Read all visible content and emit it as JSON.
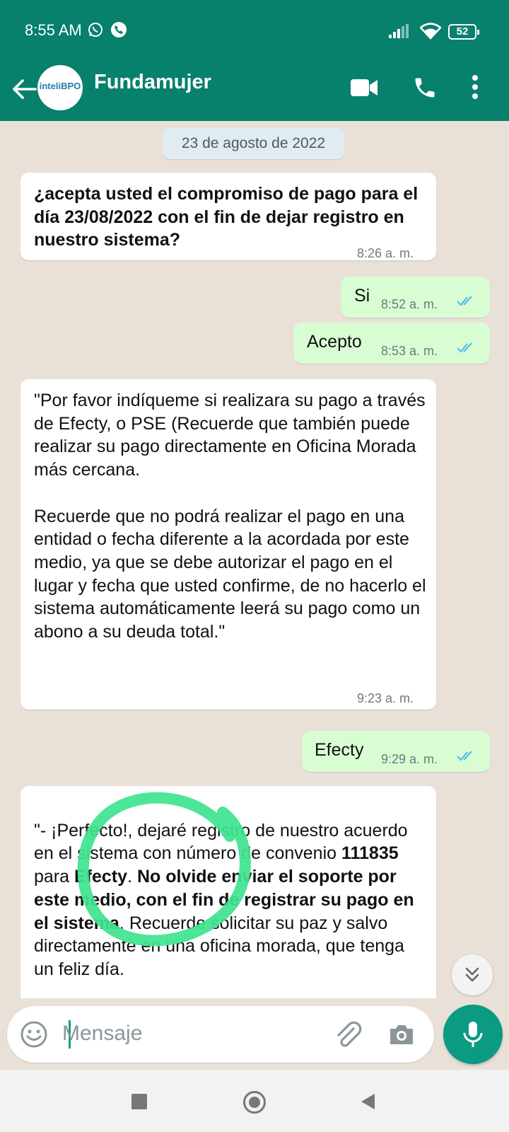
{
  "status_bar": {
    "time": "8:55 AM",
    "battery": "52"
  },
  "header": {
    "contact_name": "Fundamujer",
    "avatar_text": "inteliBPO"
  },
  "chat": {
    "date_separator": "23 de agosto de 2022",
    "messages": [
      {
        "direction": "incoming",
        "text": "¿acepta usted el compromiso de pago para el día 23/08/2022 con el fin de dejar registro en nuestro sistema?",
        "time": "8:26 a. m."
      },
      {
        "direction": "outgoing",
        "text": "Si",
        "time": "8:52 a. m.",
        "status": "read"
      },
      {
        "direction": "outgoing",
        "text": "Acepto",
        "time": "8:53 a. m.",
        "status": "read"
      },
      {
        "direction": "incoming",
        "text": "\"Por favor indíqueme si realizara su pago a través de Efecty, o PSE (Recuerde que también puede realizar su pago directamente en Oficina Morada más cercana.\n\nRecuerde que no podrá realizar el pago en una entidad o fecha diferente a la acordada por este medio, ya que se debe autorizar el pago en el lugar y fecha que usted confirme, de no hacerlo el sistema automáticamente leerá su pago como un abono a su deuda total.\"",
        "time": "9:23 a. m."
      },
      {
        "direction": "outgoing",
        "text": "Efecty",
        "time": "9:29 a. m.",
        "status": "read"
      },
      {
        "direction": "incoming",
        "parts": [
          {
            "text": "\"- ¡Perfecto!, dejaré registro de nuestro acuerdo en el sistema con número de convenio ",
            "bold": false
          },
          {
            "text": "111835",
            "bold": true
          },
          {
            "text": " para ",
            "bold": false
          },
          {
            "text": "Efecty",
            "bold": true
          },
          {
            "text": ". ",
            "bold": false
          },
          {
            "text": "No olvide enviar el soporte por este medio, con el fin de registrar su pago en el sistema",
            "bold": true
          },
          {
            "text": ". Recuerde solicitar su paz y salvo directamente en una oficina morada, que tenga un feliz día.",
            "bold": false
          }
        ]
      }
    ]
  },
  "composer": {
    "placeholder": "Mensaje"
  },
  "colors": {
    "header": "#07806c",
    "outgoing_bubble": "#d9fdd3",
    "incoming_bubble": "#ffffff",
    "accent": "#0a9b82",
    "annotation_circle": "#3fe38f"
  },
  "icons": [
    "back-arrow-icon",
    "video-call-icon",
    "voice-call-icon",
    "more-options-icon",
    "emoji-icon",
    "attach-icon",
    "camera-icon",
    "microphone-icon",
    "scroll-down-icon",
    "read-ticks-icon",
    "nav-recents-icon",
    "nav-home-icon",
    "nav-back-icon"
  ]
}
